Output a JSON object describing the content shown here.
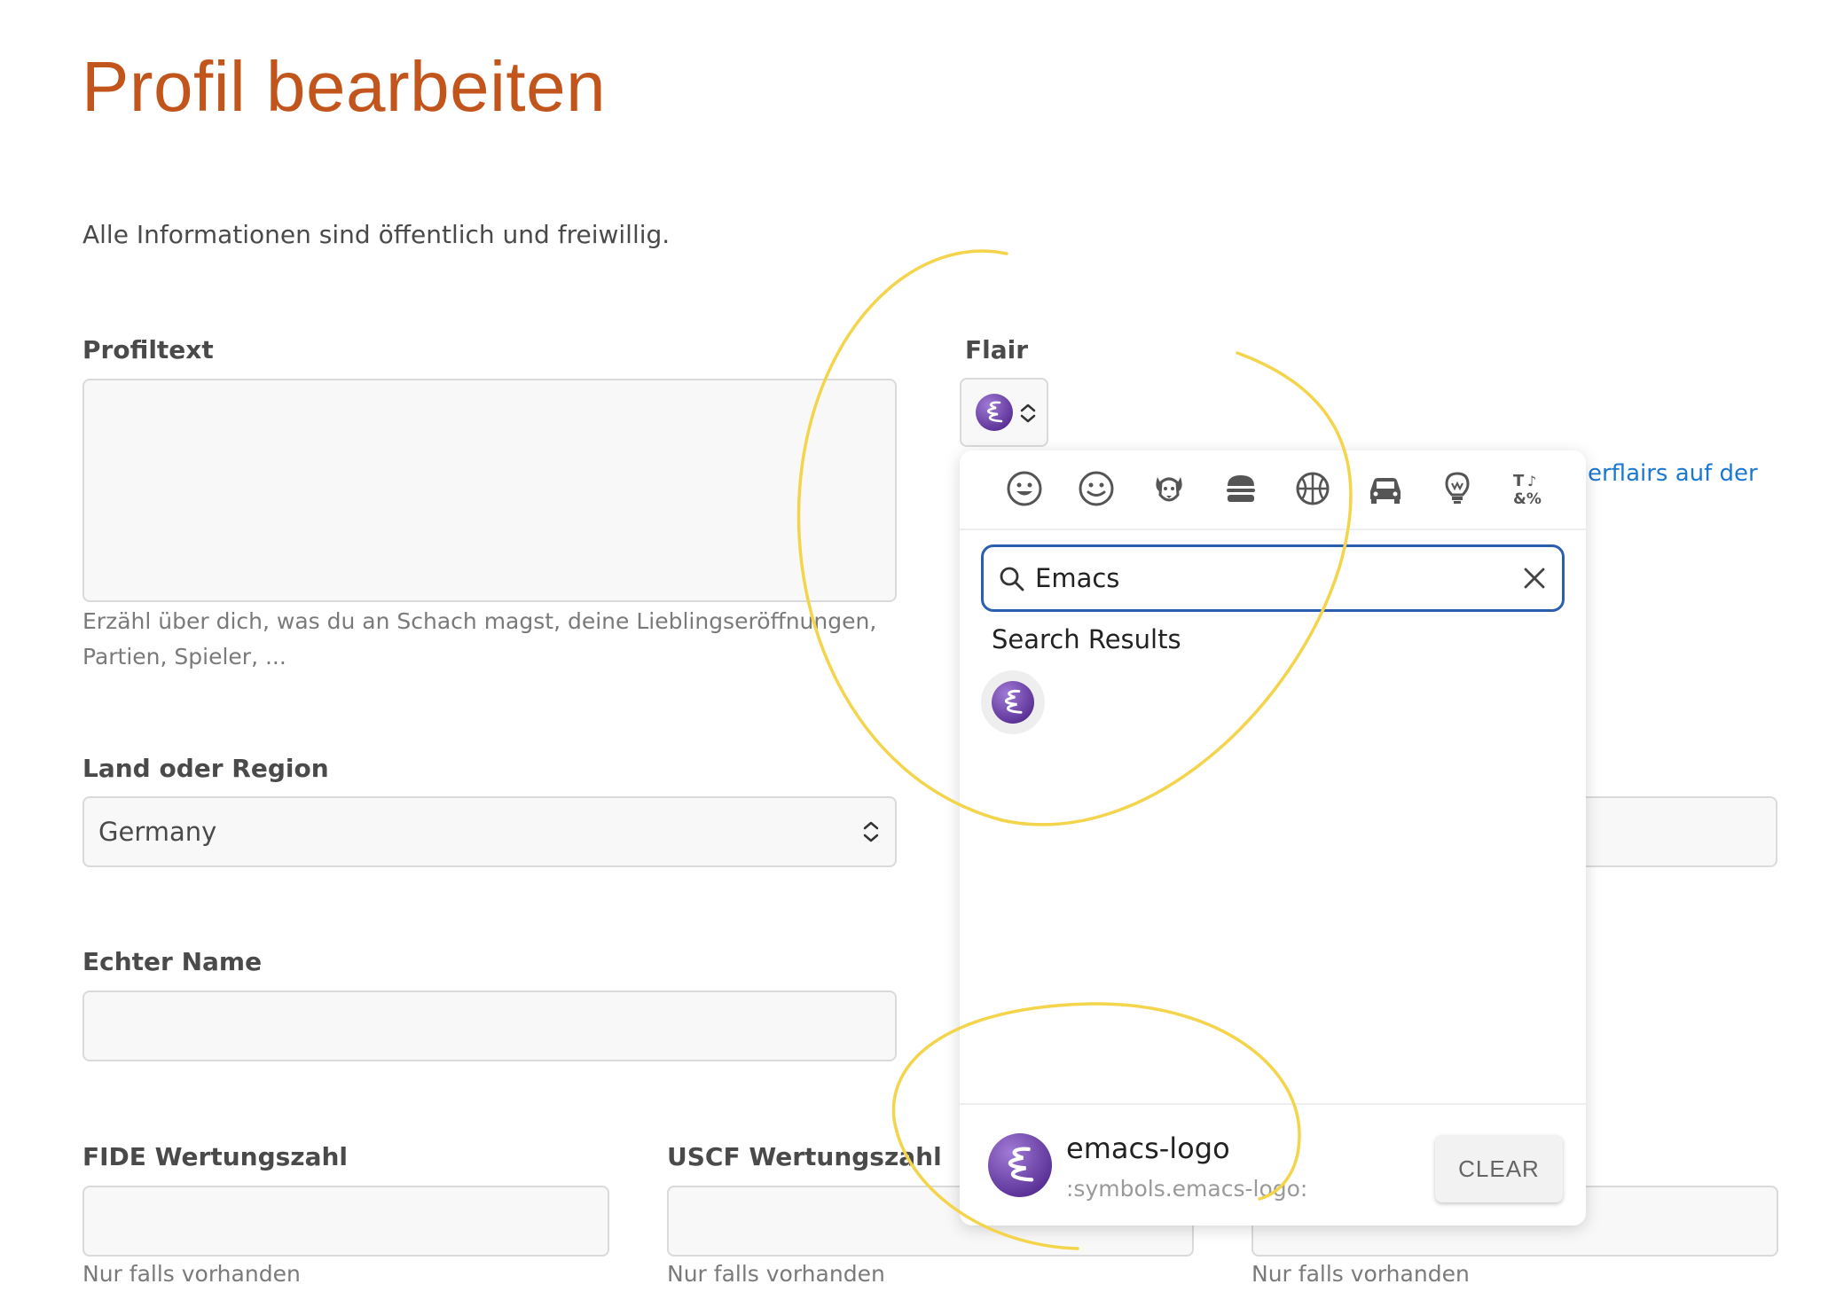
{
  "page": {
    "title": "Profil bearbeiten",
    "intro": "Alle Informationen sind öffentlich und freiwillig."
  },
  "profiltext": {
    "label": "Profiltext",
    "value": "",
    "help_line1": "Erzähl über dich, was du an Schach magst, deine Lieblingseröffnungen,",
    "help_line2": "Partien, Spieler, ..."
  },
  "flair": {
    "label": "Flair",
    "selected_icon": "emacs-logo-icon",
    "link_fragment": "erflairs auf der"
  },
  "country": {
    "label": "Land oder Region",
    "selected": "Germany"
  },
  "real_name": {
    "label": "Echter Name",
    "value": ""
  },
  "fide": {
    "label": "FIDE Wertungszahl",
    "value": "",
    "help": "Nur falls vorhanden"
  },
  "uscf": {
    "label": "USCF Wertungszahl",
    "value": "",
    "help": "Nur falls vorhanden"
  },
  "third_rating": {
    "value": "",
    "help": "Nur falls vorhanden"
  },
  "picker": {
    "categories": [
      "smiley-icon",
      "people-icon",
      "animal-icon",
      "food-icon",
      "activity-icon",
      "travel-icon",
      "objects-icon",
      "symbols-icon"
    ],
    "search_value": "Emacs",
    "results_title": "Search Results",
    "results": [
      "emacs-logo-icon"
    ],
    "preview_name": "emacs-logo",
    "preview_code": ":symbols.emacs-logo:",
    "clear_label": "CLEAR"
  },
  "colors": {
    "title": "#c1551b",
    "link": "#1b78d0",
    "search_border": "#2a5fb0",
    "annotation": "#f3d44b",
    "emacs_purple": "#6a3aa8"
  }
}
